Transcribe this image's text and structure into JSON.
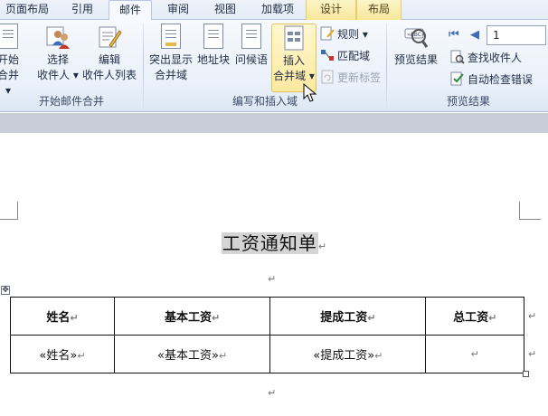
{
  "tabs": [
    {
      "label": "页面布局",
      "active": false
    },
    {
      "label": "引用",
      "active": false
    },
    {
      "label": "邮件",
      "active": true
    },
    {
      "label": "审阅",
      "active": false
    },
    {
      "label": "视图",
      "active": false
    },
    {
      "label": "加载项",
      "active": false
    },
    {
      "label": "设计",
      "active": false,
      "contextual": true
    },
    {
      "label": "布局",
      "active": false,
      "contextual": true
    }
  ],
  "ribbon": {
    "start_group": {
      "label": "开始邮件合并",
      "start_merge": {
        "line1": "开始",
        "line2": "合并 ▾"
      },
      "select_recipients": {
        "line1": "选择",
        "line2": "收件人 ▾"
      },
      "edit_recipients": {
        "line1": "编辑",
        "line2": "收件人列表"
      }
    },
    "write_group": {
      "label": "编写和插入域",
      "highlight_fields": {
        "line1": "突出显示",
        "line2": "合并域"
      },
      "address_block": {
        "line1": "地址块"
      },
      "greeting_line": {
        "line1": "问候语"
      },
      "insert_merge_field": {
        "line1": "插入",
        "line2": "合并域"
      },
      "rules": "规则 ▾",
      "match_fields": "匹配域",
      "update_labels": "更新标签"
    },
    "preview_group": {
      "label": "预览结果",
      "preview_results": "预览结果",
      "record_number": "1",
      "find_recipient": "查找收件人",
      "auto_check_errors": "自动检查错误"
    }
  },
  "document": {
    "title": "工资通知单",
    "para_mark": "↵",
    "table": {
      "headers": [
        "姓名",
        "基本工资",
        "提成工资",
        "总工资"
      ],
      "row": [
        "«姓名»",
        "«基本工资»",
        "«提成工资»",
        ""
      ]
    }
  },
  "colors": {
    "ribbon_bg": "#eaf1fa",
    "contextual_tab": "#f6e79a",
    "selected_button": "#ffe9a0"
  }
}
